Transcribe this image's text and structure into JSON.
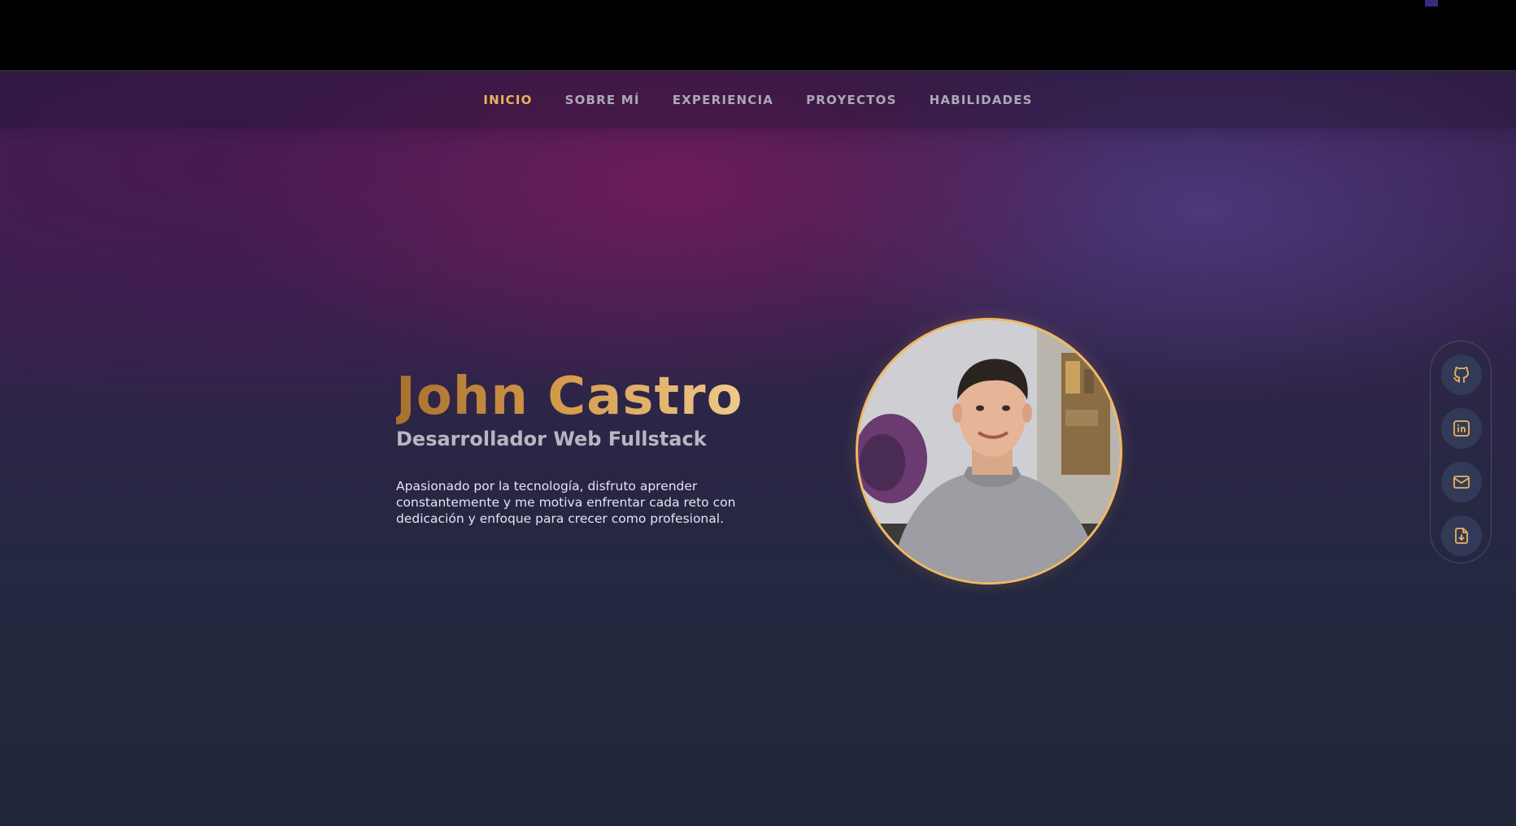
{
  "nav": {
    "items": [
      {
        "label": "INICIO",
        "active": true
      },
      {
        "label": "SOBRE MÍ",
        "active": false
      },
      {
        "label": "EXPERIENCIA",
        "active": false
      },
      {
        "label": "PROYECTOS",
        "active": false
      },
      {
        "label": "HABILIDADES",
        "active": false
      }
    ]
  },
  "hero": {
    "name": "John Castro",
    "role": "Desarrollador Web Fullstack",
    "bio": "Apasionado por la tecnología, disfruto aprender constantemente y me motiva enfrentar cada reto con dedicación y enfoque para crecer como profesional."
  },
  "social": {
    "items": [
      {
        "icon": "github-icon"
      },
      {
        "icon": "linkedin-icon"
      },
      {
        "icon": "mail-icon"
      },
      {
        "icon": "file-download-icon"
      }
    ]
  },
  "colors": {
    "accent": "#e9b25e",
    "background": "#232840",
    "nav_text": "#a9a8b6",
    "icon_color": "#e9b25e"
  }
}
